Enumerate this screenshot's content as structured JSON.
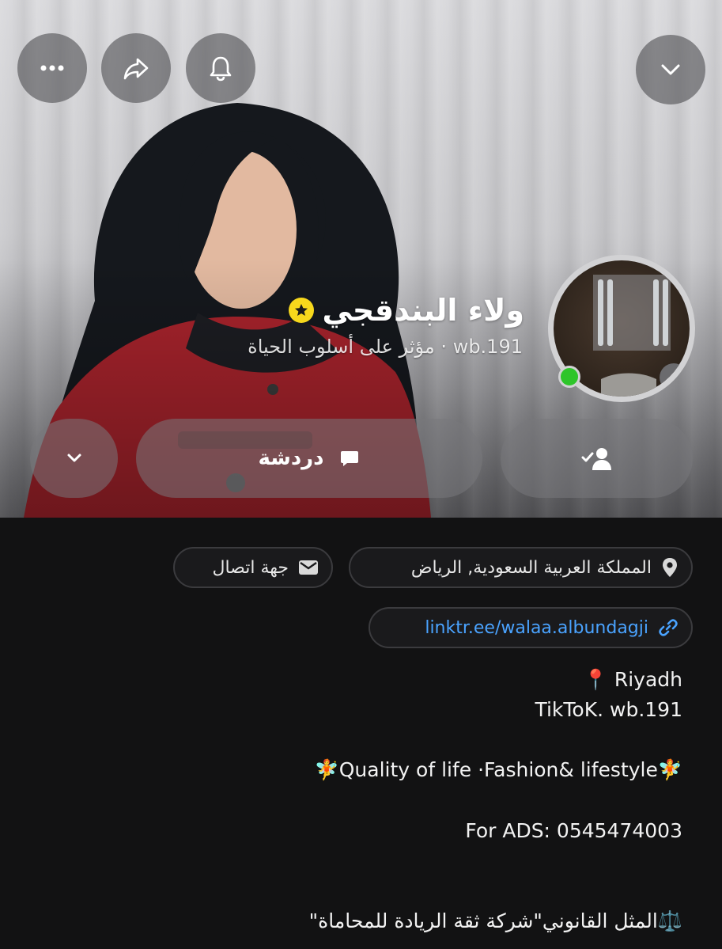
{
  "profile": {
    "name": "ولاء البندقجي",
    "subtitle": "wb.191 · مؤثر على أسلوب الحياة"
  },
  "actions": {
    "chat_label": "دردشة"
  },
  "info": {
    "location": "المملكة العربية السعودية, الرياض",
    "contact": "جهة اتصال",
    "link": "linktr.ee/walaa.albundagji"
  },
  "bio": {
    "line1": "📍 Riyadh",
    "line2": "TikToK. wb.191",
    "line3": "🧚Quality of life ·Fashion& lifestyle🧚",
    "line4": "For ADS: 0545474003",
    "line5": "⚖️المثل القانوني\"شركة ثقة الريادة للمحاماة\""
  },
  "colors": {
    "background": "#121213",
    "link": "#4aa3ff",
    "badge": "#f7d81c",
    "online": "#2ec52a"
  },
  "icons": [
    "more-icon",
    "share-icon",
    "bell-icon",
    "chevron-down-icon",
    "star-icon",
    "chat-icon",
    "add-friend-icon",
    "location-icon",
    "mail-icon",
    "link-icon"
  ]
}
